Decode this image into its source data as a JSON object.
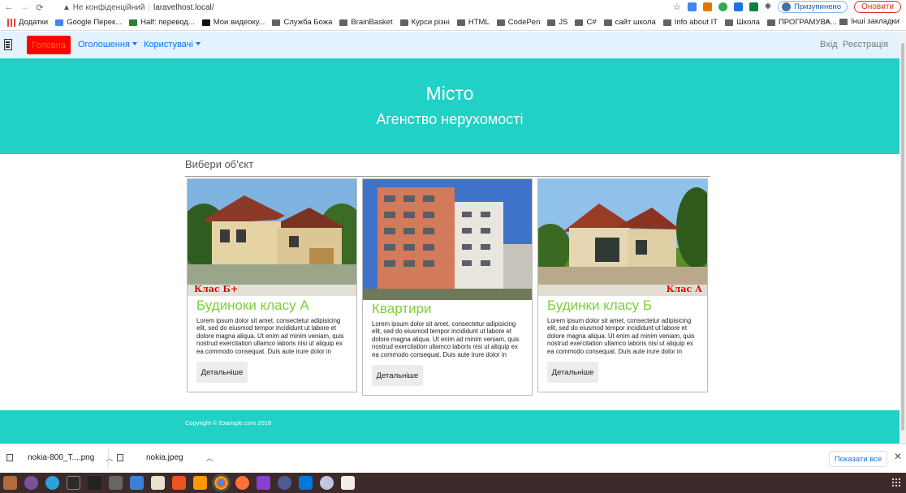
{
  "browser": {
    "warning": "Не конфіденційний",
    "url": "laravelhost.local/",
    "paused_label": "Призупинено",
    "update_label": "Оновити"
  },
  "bookmarks": {
    "items": [
      "Додатки",
      "Google Перек...",
      "Half: перевод...",
      "Мои видеоку...",
      "Служба Божа",
      "BrainBasket",
      "Курси різні",
      "HTML",
      "CodePen",
      "JS",
      "C#",
      "сайт школа",
      "Info about IT",
      "Школа",
      "ПРОГРАМУВА..."
    ],
    "more": "»",
    "other": "Інші закладки"
  },
  "navbar": {
    "home": "Головна",
    "announcements": "Оголошення",
    "users": "Користувачі",
    "login": "Вхід",
    "register": "Реєстрація"
  },
  "hero": {
    "title": "Місто",
    "subtitle": "Агенство нерухомості"
  },
  "section_title": "Вибери об'єкт",
  "cards": [
    {
      "title": "Будиноки класу А",
      "badge": "Клас Б+",
      "text": "Lorem ipsum dolor sit amet, consectetur adipisicing elit, sed do eiusmod tempor incididunt ut labore et dolore magna aliqua. Ut enim ad minim veniam, quis nostrud exercitation ullamco laboris nisi ut aliquip ex ea commodo consequat. Duis aute irure dolor in",
      "button": "Детальніше"
    },
    {
      "title": "Квартири",
      "badge": "",
      "text": "Lorem ipsum dolor sit amet, consectetur adipisicing elit, sed do eiusmod tempor incididunt ut labore et dolore magna aliqua. Ut enim ad minim veniam, quis nostrud exercitation ullamco laboris nisi ut aliquip ex ea commodo consequat. Duis aute irure dolor in",
      "button": "Детальніше"
    },
    {
      "title": "Будинки класу Б",
      "badge": "Клас А",
      "text": "Lorem ipsum dolor sit amet, consectetur adipisicing elit, sed do eiusmod tempor incididunt ut labore et dolore magna aliqua. Ut enim ad minim veniam, quis nostrud exercitation ullamco laboris nisi ut aliquip ex ea commodo consequat. Duis aute irure dolor in",
      "button": "Детальніше"
    }
  ],
  "footer": "Copyright © Example.com 2018",
  "downloads": {
    "files": [
      "nokia-800_T....png",
      "nokia.jpeg"
    ],
    "show_all": "Показати все"
  },
  "colors": {
    "accent": "#21d1c6",
    "title_green": "#7ccf3c",
    "home_button": "#ff0000"
  },
  "taskbar_icons": [
    "files-icon",
    "viber-icon",
    "telegram-icon",
    "terminal-icon",
    "inkscape-icon",
    "camera-icon",
    "document-icon",
    "notes-icon",
    "software-center-icon",
    "sublime-icon",
    "chrome-icon",
    "firefox-icon",
    "phpstorm-icon",
    "php-icon",
    "vscode-icon",
    "remmina-icon",
    "text-editor-icon"
  ]
}
